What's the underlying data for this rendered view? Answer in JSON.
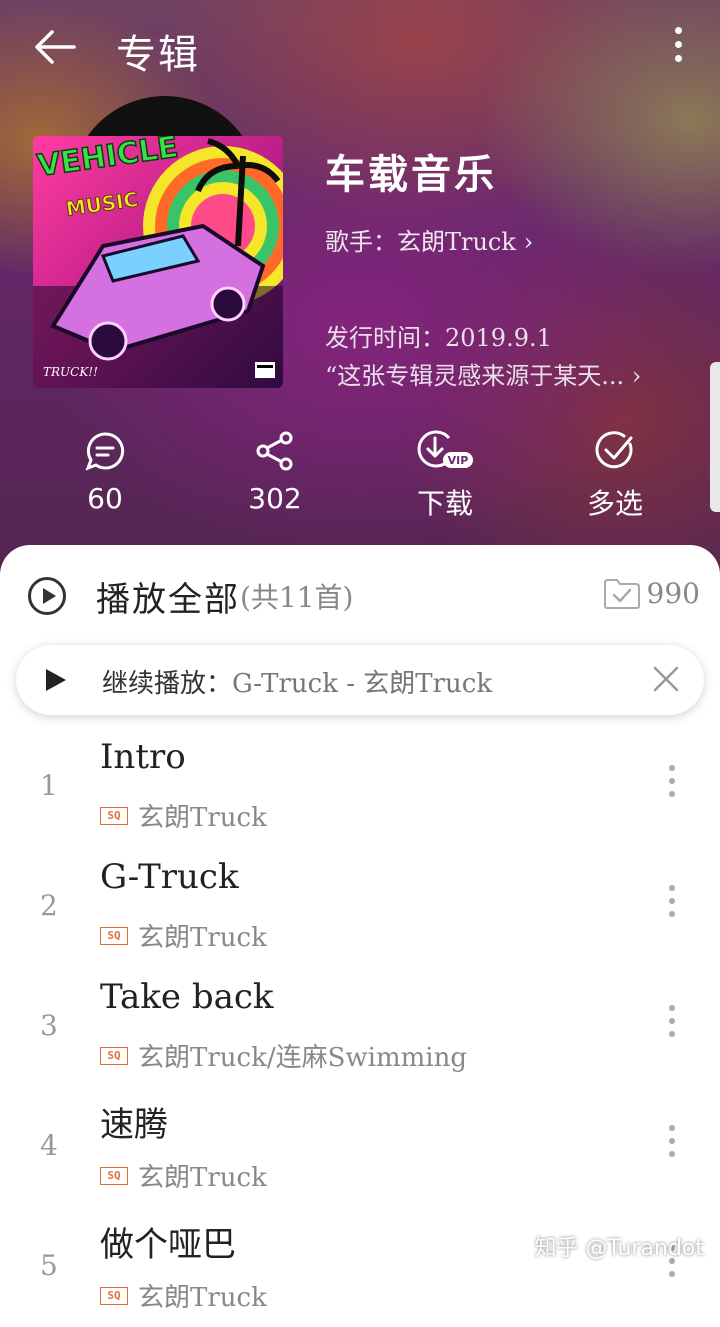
{
  "header": {
    "title": "专辑"
  },
  "album": {
    "name": "车载音乐",
    "artist_line": "歌手：玄朗Truck",
    "release": "发行时间：2019.9.1",
    "description": "“这张专辑灵感来源于某天..."
  },
  "cover_art": {
    "logo_line1": "VEHICLE",
    "logo_line2": "MUSIC",
    "signature": "TRUCK!!"
  },
  "actions": [
    {
      "icon": "comment-icon",
      "label": "60"
    },
    {
      "icon": "share-icon",
      "label": "302"
    },
    {
      "icon": "download-vip-icon",
      "label": "下载",
      "badge": "VIP"
    },
    {
      "icon": "multi-select-icon",
      "label": "多选"
    }
  ],
  "playlist": {
    "play_all": "播放全部",
    "count": "(共11首)",
    "collect_count": "990",
    "resume_prefix": "继续播放：",
    "resume_song": "G-Truck - 玄朗Truck"
  },
  "quality_badge": "SQ",
  "songs": [
    {
      "num": "1",
      "title": "Intro",
      "artist": "玄朗Truck"
    },
    {
      "num": "2",
      "title": "G-Truck",
      "artist": "玄朗Truck"
    },
    {
      "num": "3",
      "title": "Take back",
      "artist": "玄朗Truck/连麻Swimming"
    },
    {
      "num": "4",
      "title": "速腾",
      "artist": "玄朗Truck"
    },
    {
      "num": "5",
      "title": "做个哑巴",
      "artist": "玄朗Truck"
    }
  ],
  "watermark": "知乎 @Turandot",
  "colors": {
    "accent_sq": "#e0703a",
    "text_primary": "#222222",
    "text_secondary": "#888888"
  }
}
